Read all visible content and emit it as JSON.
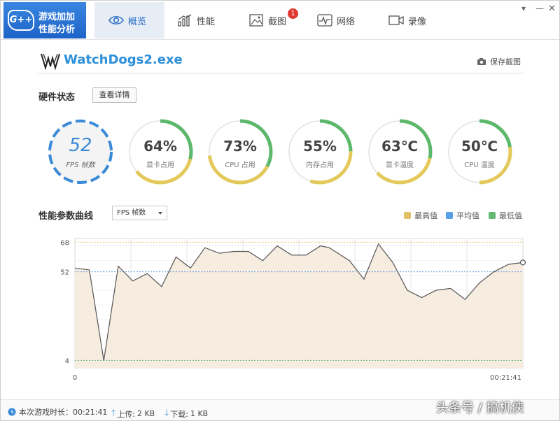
{
  "app": {
    "logo_badge": "G++",
    "logo_line1": "游戏加加",
    "logo_line2": "性能分析"
  },
  "tabs": [
    {
      "label": "概览",
      "icon": "eye-icon",
      "active": true
    },
    {
      "label": "性能",
      "icon": "bar-chart-icon",
      "active": false
    },
    {
      "label": "截图",
      "icon": "image-icon",
      "active": false,
      "badge": "1"
    },
    {
      "label": "网络",
      "icon": "pulse-icon",
      "active": false
    },
    {
      "label": "录像",
      "icon": "video-icon",
      "active": false
    }
  ],
  "window": {
    "minimize": "▾",
    "close": "—"
  },
  "process": {
    "name": "WatchDogs2.exe",
    "save_label": "保存截图"
  },
  "hardware": {
    "title": "硬件状态",
    "detail_button": "查看详情",
    "gauges": [
      {
        "value": "52",
        "label": "FPS 帧数",
        "kind": "fps",
        "percent": 100
      },
      {
        "value": "64%",
        "label": "显卡占用",
        "kind": "ring",
        "percent": 64
      },
      {
        "value": "73%",
        "label": "CPU 占用",
        "kind": "ring",
        "percent": 73
      },
      {
        "value": "55%",
        "label": "内存占用",
        "kind": "ring",
        "percent": 55
      },
      {
        "value": "63℃",
        "label": "显卡温度",
        "kind": "ring",
        "percent": 63
      },
      {
        "value": "50℃",
        "label": "CPU 温度",
        "kind": "ring",
        "percent": 50
      }
    ],
    "colors": {
      "ring_yellow": "#e3c85a",
      "ring_green": "#5cb86a",
      "ring_track": "#e1e1e1",
      "fps_blue": "#3a8ad8"
    }
  },
  "curve": {
    "title": "性能参数曲线",
    "select_value": "FPS 帧数",
    "legend": [
      {
        "label": "最高值",
        "color": "#e1c168"
      },
      {
        "label": "平均值",
        "color": "#5a9ee6"
      },
      {
        "label": "最低值",
        "color": "#63b873"
      }
    ]
  },
  "chart_data": {
    "type": "area",
    "y_ticks": [
      68,
      52,
      4
    ],
    "x_tick_labels": [
      "0",
      "00:21:41"
    ],
    "ylim": [
      0,
      70
    ],
    "max_line": 68,
    "avg_line": 52,
    "min_line": 4,
    "x": [
      0,
      1,
      2,
      3,
      4,
      5,
      6,
      7,
      8,
      9,
      10,
      11,
      12,
      13,
      14,
      15,
      16,
      17,
      17.6,
      18,
      19,
      20,
      21,
      22,
      23,
      24,
      25,
      26,
      27,
      28,
      29,
      30,
      31
    ],
    "values": [
      54,
      53,
      4,
      55,
      47,
      51,
      44,
      60,
      54,
      65,
      62,
      63,
      63,
      58,
      66,
      61,
      61,
      66,
      65,
      63,
      58,
      48,
      67,
      57,
      42,
      38,
      42,
      43,
      37,
      46,
      52,
      56,
      57
    ],
    "line_color": "#555555",
    "fill_color": "#f6ece0"
  },
  "status": {
    "playtime_label": "本次游戏时长：",
    "playtime_value": "00:21:41",
    "upload_label": "上传:",
    "upload_value": "2 KB",
    "download_label": "下载:",
    "download_value": "1 KB"
  },
  "watermark": "头条号 / 搞机侠"
}
